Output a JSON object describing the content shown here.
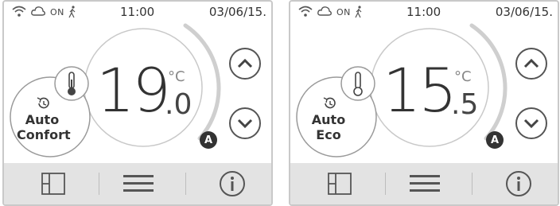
{
  "panels": [
    {
      "status": {
        "on_label": "ON",
        "time": "11:00",
        "date": "03/06/15."
      },
      "temperature": {
        "integer": "19",
        "decimal": ".0",
        "unit": "°C",
        "value": 19.0
      },
      "mode": {
        "line1": "Auto",
        "line2": "Confort"
      },
      "marker": "A",
      "icons": [
        "wifi-icon",
        "cloud-icon",
        "walking-person-icon",
        "thermometer-icon",
        "clock-icon",
        "chevron-up-icon",
        "chevron-down-icon",
        "window-icon",
        "menu-icon",
        "info-icon"
      ]
    },
    {
      "status": {
        "on_label": "ON",
        "time": "11:00",
        "date": "03/06/15."
      },
      "temperature": {
        "integer": "15",
        "decimal": ".5",
        "unit": "°C",
        "value": 15.5
      },
      "mode": {
        "line1": "Auto",
        "line2": "Eco"
      },
      "marker": "A",
      "icons": [
        "wifi-icon",
        "cloud-icon",
        "walking-person-icon",
        "thermometer-icon",
        "clock-icon",
        "chevron-up-icon",
        "chevron-down-icon",
        "window-icon",
        "menu-icon",
        "info-icon"
      ]
    }
  ],
  "colors": {
    "ring": "#c9c9c9",
    "text": "#333333",
    "bottom_bar": "#e3e3e3"
  }
}
